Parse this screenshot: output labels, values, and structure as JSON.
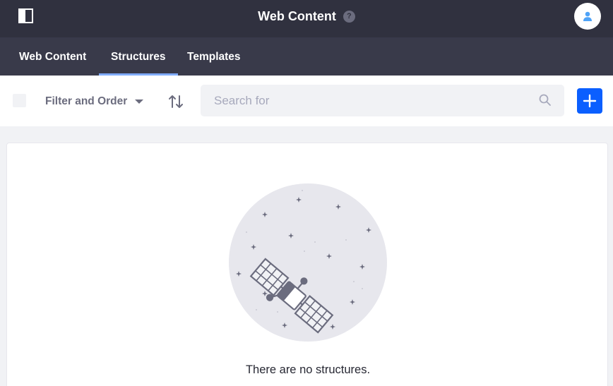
{
  "header": {
    "title": "Web Content",
    "help_glyph": "?",
    "icons": {
      "panel_toggle": "product-menu-icon",
      "help": "question-circle-icon",
      "user": "user-avatar-icon"
    },
    "colors": {
      "background": "#30313f",
      "text": "#ffffff"
    }
  },
  "nav": {
    "tabs": [
      {
        "label": "Web Content",
        "active": false
      },
      {
        "label": "Structures",
        "active": true
      },
      {
        "label": "Templates",
        "active": false
      }
    ],
    "colors": {
      "background": "#393a4a",
      "active_underline": "#80acff"
    }
  },
  "toolbar": {
    "select_all_checked": false,
    "filter_label": "Filter and Order",
    "filter_icon": "caret-down-icon",
    "sort_icon": "order-arrow-icon",
    "search": {
      "placeholder": "Search for",
      "value": "",
      "icon": "search-icon"
    },
    "add_icon": "plus-icon",
    "colors": {
      "primary": "#0b5fff",
      "muted_text": "#6b6c7e"
    }
  },
  "empty_state": {
    "illustration": "satellite-icon",
    "message": "There are no structures."
  }
}
